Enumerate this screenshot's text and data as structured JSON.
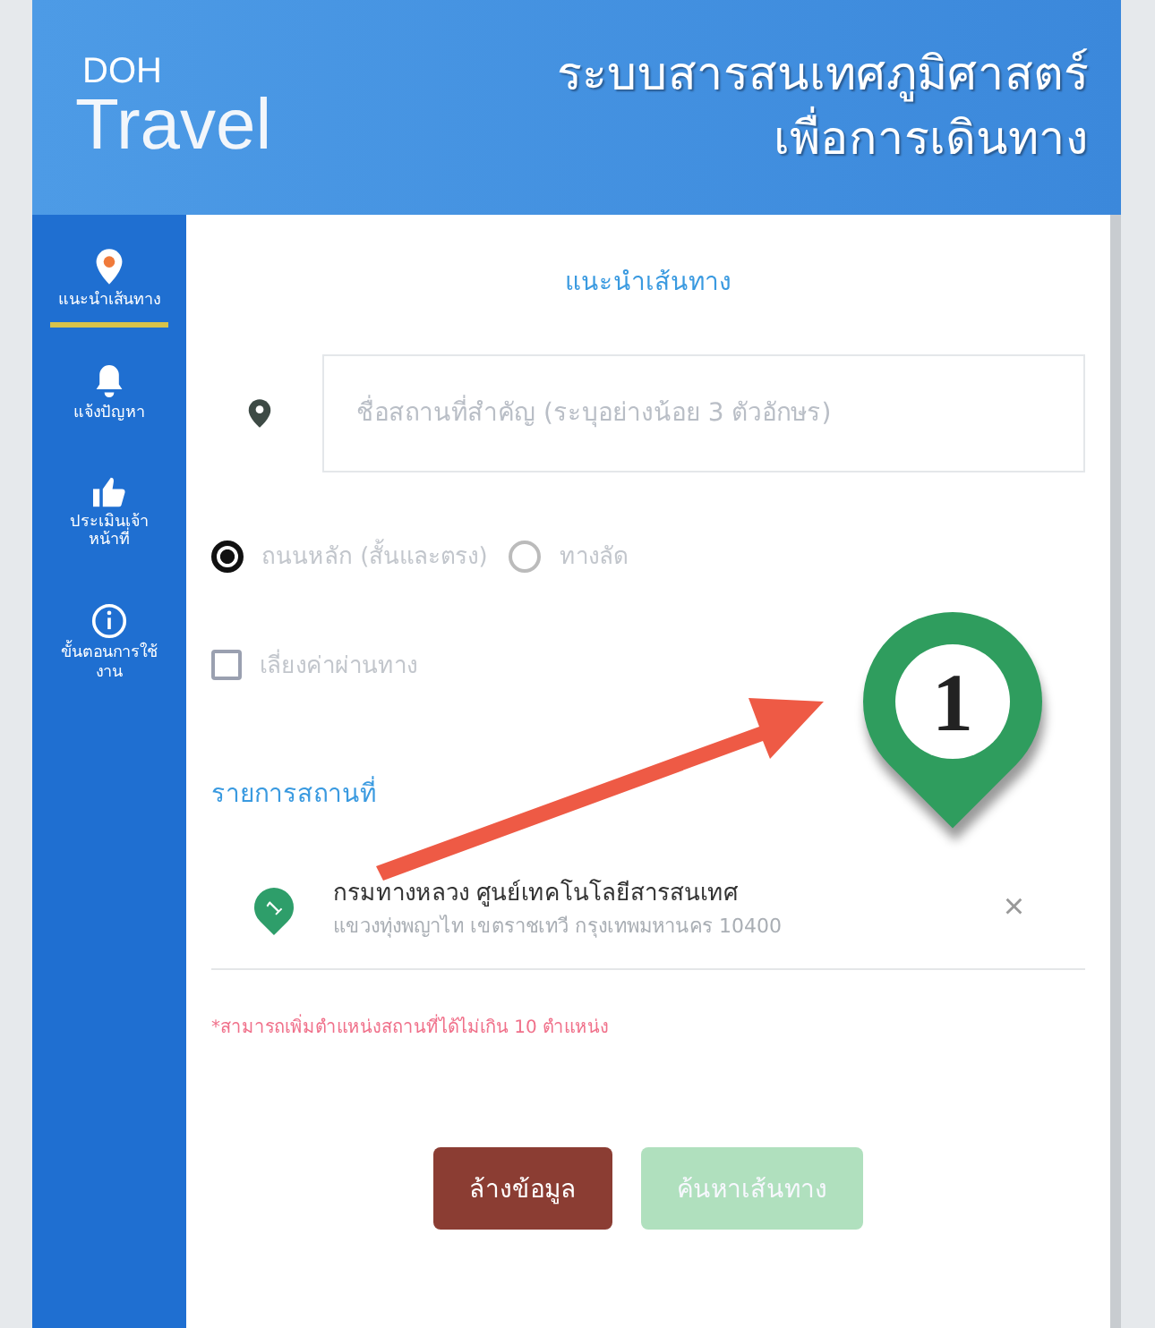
{
  "logo": {
    "line_1": "DOH",
    "line_2": "Travel"
  },
  "header": {
    "title_lines": [
      "ระบบสารสนเทศภูมิศาสตร์",
      "เพื่อการเดินทาง"
    ]
  },
  "sidebar": {
    "items": [
      {
        "kind": "pin",
        "label": "แนะนำเส้นทาง",
        "selected": true
      },
      {
        "kind": "bell",
        "label": "แจ้งปัญหา",
        "selected": false
      },
      {
        "kind": "thumb",
        "label": "ประเมินเจ้าหน้าที่",
        "selected": false
      },
      {
        "kind": "info",
        "label": "ขั้นตอนการใช้งาน",
        "selected": false
      }
    ]
  },
  "panel": {
    "title": "แนะนำเส้นทาง",
    "search": {
      "placeholder": "ชื่อสถานที่สำคัญ (ระบุอย่างน้อย 3 ตัวอักษร)"
    },
    "route_options": [
      {
        "label": "ถนนหลัก (สั้นและตรง)",
        "selected": true
      },
      {
        "label": "ทางลัด",
        "selected": false
      }
    ],
    "avoid_toll": {
      "label": "เลี่ยงค่าผ่านทาง",
      "checked": false
    },
    "places_heading": "รายการสถานที่",
    "places": [
      {
        "number": "1",
        "name": "กรมทางหลวง ศูนย์เทคโนโลยีสารสนเทศ",
        "address": "แขวงทุ่งพญาไท เขตราชเทวี กรุงเทพมหานคร 10400",
        "remove": "×"
      }
    ],
    "note": "*สามารถเพิ่มตำแหน่งสถานที่ได้ไม่เกิน 10 ตำแหน่ง",
    "buttons": [
      {
        "kind": "clear",
        "label": "ล้างข้อมูล",
        "disabled": false
      },
      {
        "kind": "search",
        "label": "ค้นหาเส้นทาง",
        "disabled": true
      }
    ]
  },
  "annotation": {
    "number": "1"
  }
}
